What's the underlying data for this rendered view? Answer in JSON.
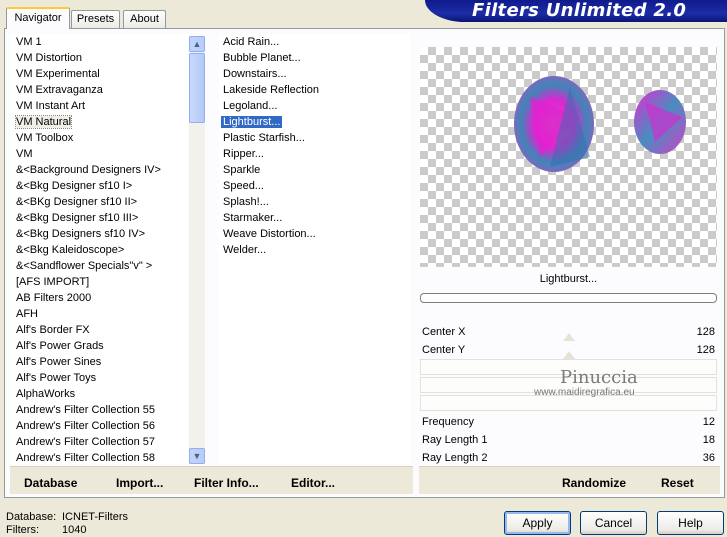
{
  "title_banner": "Filters Unlimited 2.0",
  "tabs": [
    "Navigator",
    "Presets",
    "About"
  ],
  "categories": [
    "VM 1",
    "VM Distortion",
    "VM Experimental",
    "VM Extravaganza",
    "VM Instant Art",
    "VM Natural",
    "VM Toolbox",
    "VM",
    "&<Background Designers IV>",
    "&<Bkg Designer sf10 I>",
    "&<BKg Designer sf10 II>",
    "&<Bkg Designer sf10 III>",
    "&<Bkg Designers sf10 IV>",
    "&<Bkg Kaleidoscope>",
    "&<Sandflower Specials\"v\" >",
    "[AFS IMPORT]",
    "AB Filters 2000",
    "AFH",
    "Alf's Border FX",
    "Alf's Power Grads",
    "Alf's Power Sines",
    "Alf's Power Toys",
    "AlphaWorks",
    "Andrew's Filter Collection 55",
    "Andrew's Filter Collection 56",
    "Andrew's Filter Collection 57",
    "Andrew's Filter Collection 58"
  ],
  "selected_category": "VM Natural",
  "filters": [
    "Acid Rain...",
    "Bubble Planet...",
    "Downstairs...",
    "Lakeside Reflection",
    "Legoland...",
    "Lightburst...",
    "Plastic Starfish...",
    "Ripper...",
    "Sparkle",
    "Speed...",
    "Splash!...",
    "Starmaker...",
    "Weave Distortion...",
    "Welder..."
  ],
  "selected_filter": "Lightburst...",
  "preview_filter_name": "Lightburst...",
  "watermark": {
    "line1": "Pinuccia",
    "line2": "www.maidiregrafica.eu"
  },
  "params": [
    {
      "label": "Center X",
      "value": "128"
    },
    {
      "label": "Center Y",
      "value": "128"
    },
    {
      "label": "Frequency",
      "value": "12"
    },
    {
      "label": "Ray Length 1",
      "value": "18"
    },
    {
      "label": "Ray Length 2",
      "value": "36"
    }
  ],
  "toolbar": {
    "database_label": "Database",
    "import_label": "Import...",
    "filterinfo_label": "Filter Info...",
    "editor_label": "Editor...",
    "randomize_label": "Randomize",
    "reset_label": "Reset"
  },
  "status": {
    "database_label": "Database:",
    "database_value": "ICNET-Filters",
    "filters_label": "Filters:",
    "filters_value": "1040"
  },
  "buttons": {
    "apply": "Apply",
    "cancel": "Cancel",
    "help": "Help"
  },
  "colors": {
    "selection": "#316ac5",
    "banner": "#1c2da6",
    "accent_magenta": "#e020d0",
    "accent_blue": "#3a7ab8"
  }
}
